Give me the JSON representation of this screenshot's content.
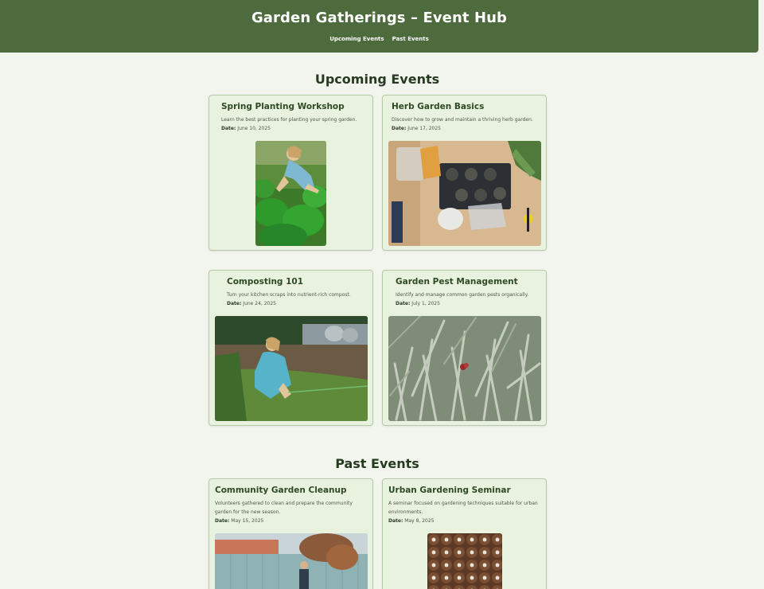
{
  "header": {
    "title": "Garden Gatherings – Event Hub",
    "nav": [
      "Upcoming Events",
      "Past Events"
    ]
  },
  "sections": {
    "upcoming": "Upcoming Events",
    "past": "Past Events"
  },
  "date_label": "Date:",
  "upcoming_events": [
    {
      "title": "Spring Planting Workshop",
      "description": "Learn the best practices for planting your spring garden.",
      "date": "June 10, 2025"
    },
    {
      "title": "Herb Garden Basics",
      "description": "Discover how to grow and maintain a thriving herb garden.",
      "date": "June 17, 2025"
    },
    {
      "title": "Composting 101",
      "description": "Turn your kitchen scraps into nutrient-rich compost.",
      "date": "June 24, 2025"
    },
    {
      "title": "Garden Pest Management",
      "description": "Identify and manage common garden pests organically.",
      "date": "July 1, 2025"
    }
  ],
  "past_events": [
    {
      "title": "Community Garden Cleanup",
      "description": "Volunteers gathered to clean and prepare the community garden for the new season.",
      "date": "May 15, 2025"
    },
    {
      "title": "Urban Gardening Seminar",
      "description": "A seminar focused on gardening techniques suitable for urban environments.",
      "date": "May 8, 2025"
    }
  ],
  "colors": {
    "header_bg": "#4e6b3d",
    "page_bg": "#f2f4ee",
    "card_bg": "#e8f2df",
    "card_border": "#b6c9a8",
    "title_text": "#2e4a24"
  }
}
